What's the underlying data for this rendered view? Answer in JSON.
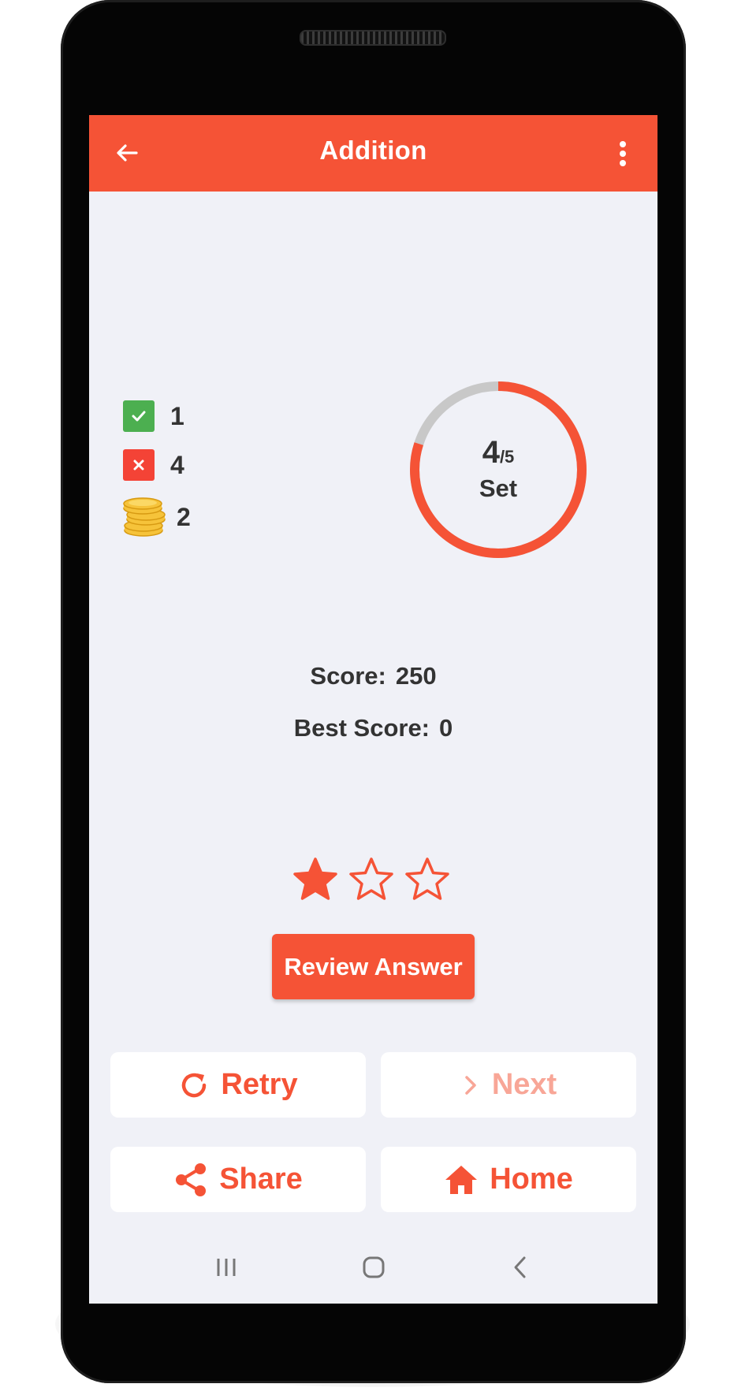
{
  "app": {
    "title": "Addition"
  },
  "stats": {
    "correct": "1",
    "wrong": "4",
    "coins": "2"
  },
  "progress": {
    "current": "4",
    "total": "/5",
    "label": "Set",
    "fraction": 0.8
  },
  "score": {
    "label": "Score:",
    "value": "250",
    "best_label": "Best Score:",
    "best_value": "0"
  },
  "rating": {
    "stars_filled": 1,
    "stars_total": 3
  },
  "buttons": {
    "review": "Review Answer",
    "retry": "Retry",
    "next": "Next",
    "share": "Share",
    "home": "Home"
  },
  "icons": {
    "back": "arrow-left-icon",
    "menu": "more-vert-icon",
    "correct": "check-icon",
    "wrong": "close-icon",
    "coins": "coins-icon",
    "retry": "refresh-icon",
    "next": "chevron-right-icon",
    "share": "share-icon",
    "home": "home-icon"
  },
  "colors": {
    "accent": "#f55336",
    "accent_disabled": "#f8a697",
    "correct": "#4caf50",
    "wrong": "#f44336",
    "ring_track": "#c8c8c8",
    "background": "#f0f1f7",
    "text": "#333333"
  }
}
